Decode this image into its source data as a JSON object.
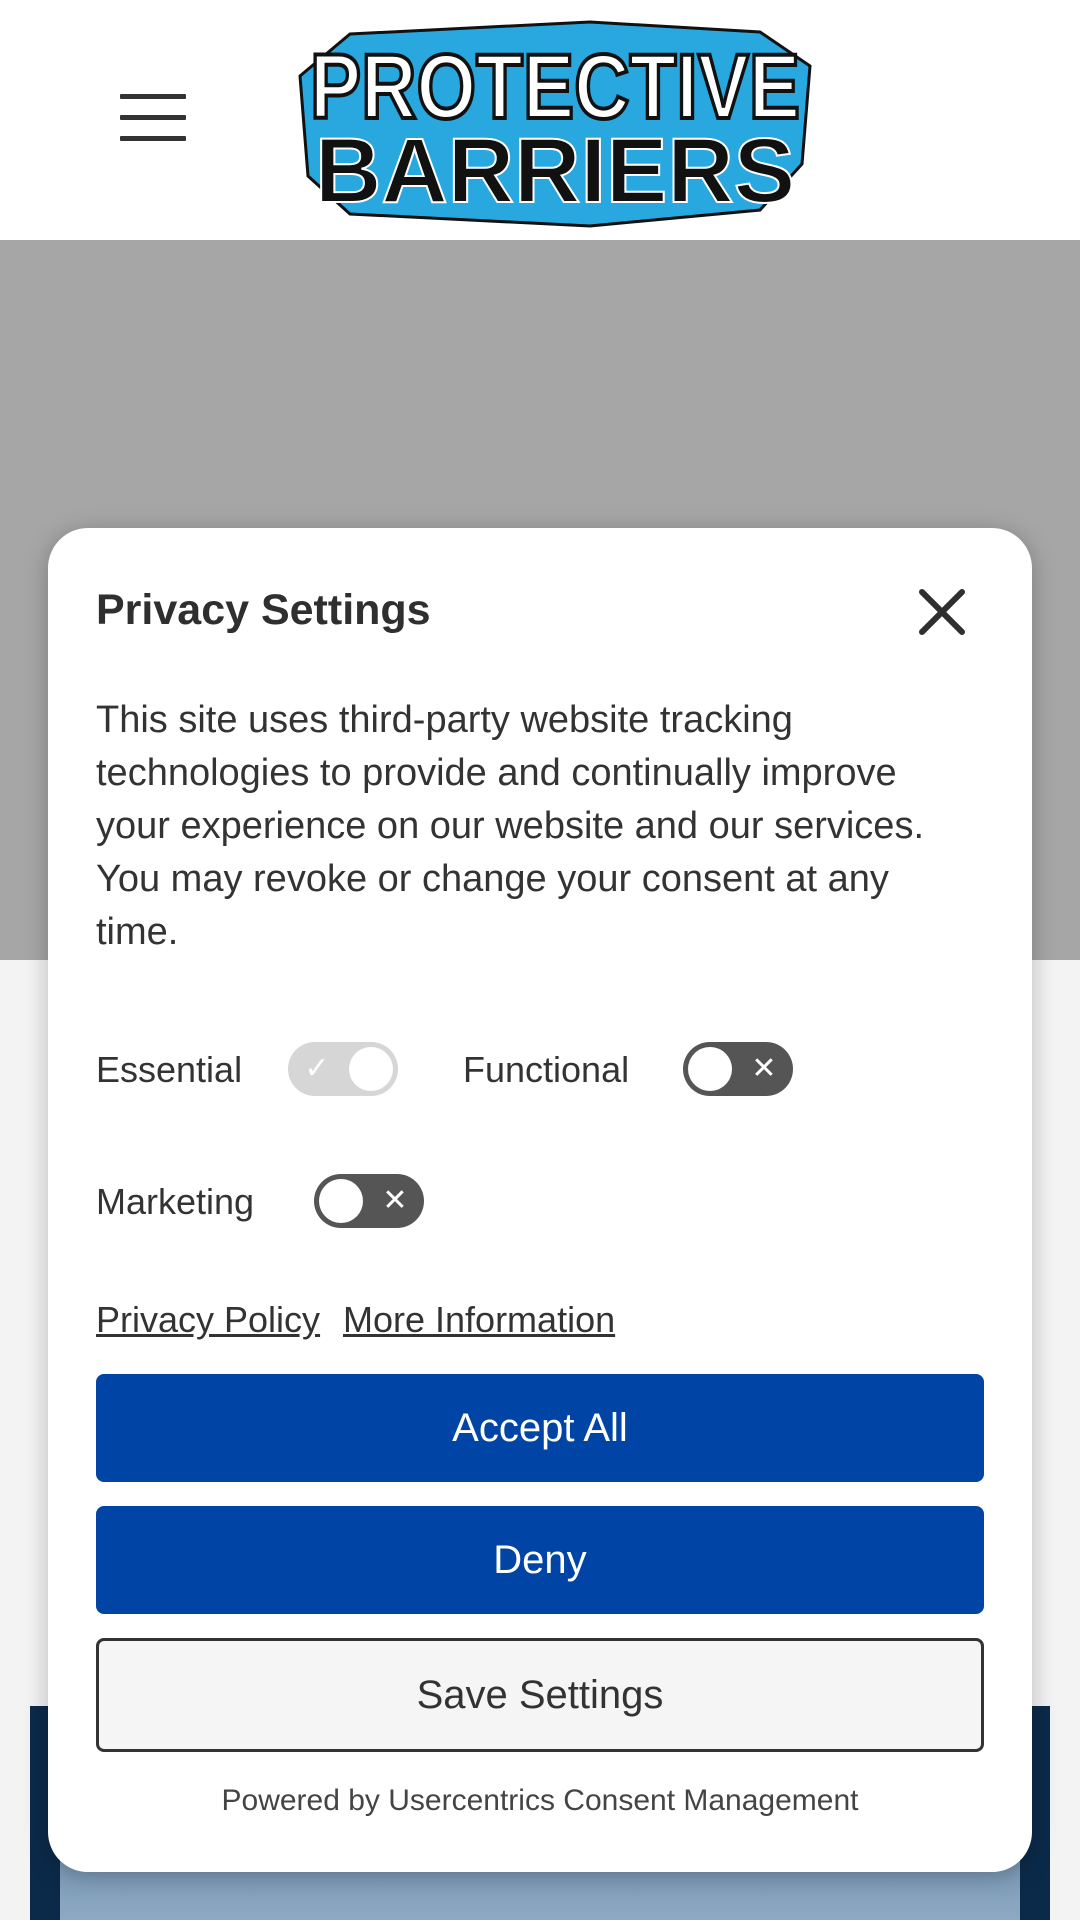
{
  "header": {
    "menu_label": "Menu",
    "logo": {
      "line1": "PROTECTIVE",
      "line2": "BARRIERS",
      "accent_color": "#29a8e0"
    }
  },
  "dialog": {
    "title": "Privacy Settings",
    "description": "This site uses third-party website tracking technologies to provide and continually improve your experience on our website and our services. You may revoke or change your consent at any time.",
    "toggles": [
      {
        "label": "Essential",
        "state": "on",
        "disabled": true
      },
      {
        "label": "Functional",
        "state": "off",
        "disabled": false
      },
      {
        "label": "Marketing",
        "state": "off",
        "disabled": false
      }
    ],
    "links": {
      "privacy_policy": "Privacy Policy",
      "more_information": "More Information"
    },
    "buttons": {
      "accept_all": "Accept All",
      "deny": "Deny",
      "save_settings": "Save Settings"
    },
    "footer": "Powered by Usercentrics Consent Management"
  },
  "colors": {
    "primary_button": "#0045a5",
    "backdrop_gray": "#a6a6a6",
    "toggle_off": "#555555",
    "toggle_disabled": "#d6d6d6"
  },
  "icons": {
    "menu": "hamburger-icon",
    "close": "close-icon",
    "toggle_on": "check-icon",
    "toggle_off": "x-icon"
  }
}
